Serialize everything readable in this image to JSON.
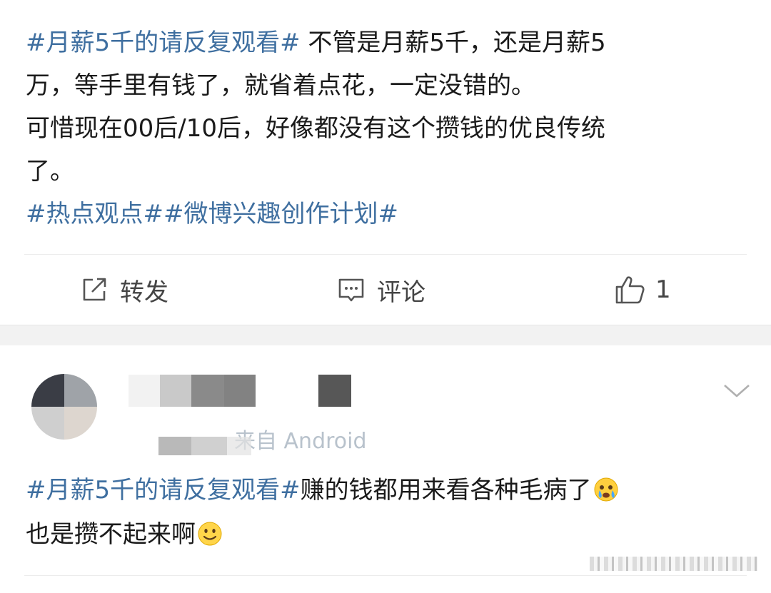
{
  "post1": {
    "text": {
      "hashtag_1": "#月薪5千的请反复观看#",
      "line_1_rest": " 不管是月薪5千，还是月薪5",
      "line_2": "万，等手里有钱了，就省着点花，一定没错的。",
      "line_3": "可惜现在00后/10后，好像都没有这个攒钱的优良传统",
      "line_4": "了。",
      "hashtag_2": "#热点观点#",
      "hashtag_3": "#微博兴趣创作计划#"
    },
    "actions": {
      "repost_label": "转发",
      "repost_icon": "share-icon",
      "comment_label": "评论",
      "comment_icon": "comment-icon",
      "like_count": "1",
      "like_icon": "thumbs-up-icon"
    }
  },
  "post2": {
    "meta_text": "来自 Android",
    "text": {
      "hashtag_1": "#月薪5千的请反复观看#",
      "line_1_rest": "赚的钱都用来看各种毛病了",
      "emoji_1": "crying-emoji",
      "line_2": "也是攒不起来啊",
      "emoji_2": "smile-emoji"
    },
    "expand_icon": "chevron-down-icon"
  },
  "colors": {
    "hashtag": "#3f6fa0",
    "text": "#1a1a1a",
    "action": "#444444",
    "separator": "#f2f2f2"
  }
}
